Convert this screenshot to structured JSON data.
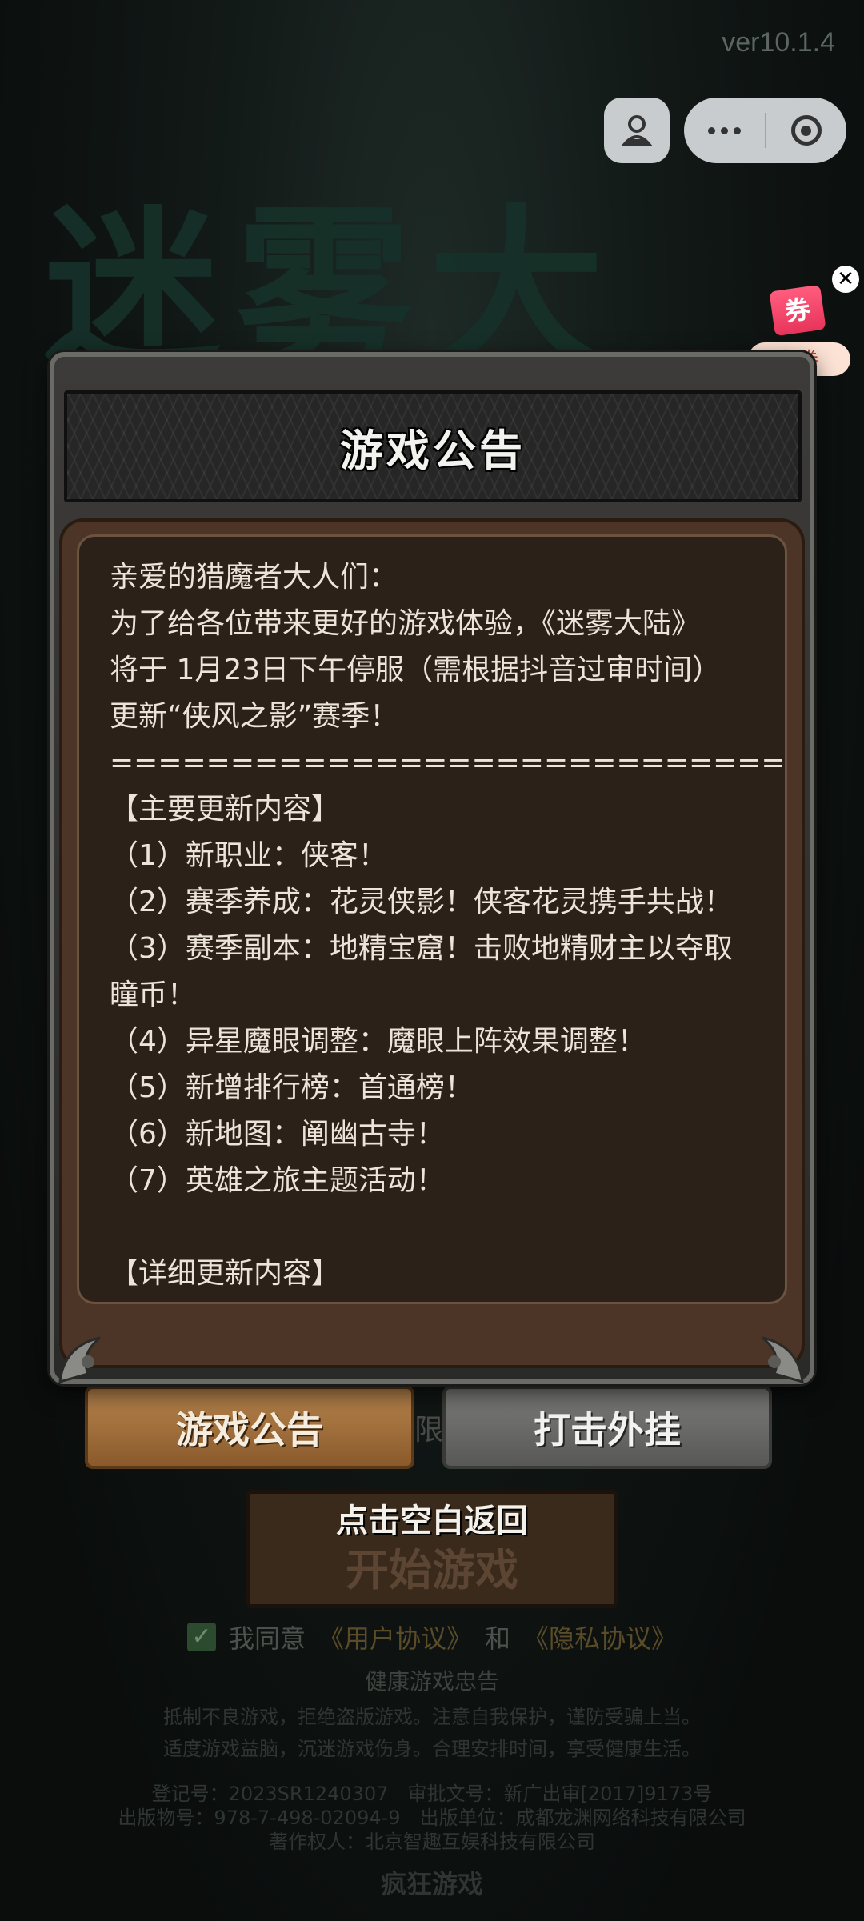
{
  "version": "ver10.1.4",
  "logo": {
    "text": "迷雾大陆"
  },
  "capsule": {
    "left_icon": "game-avatar-icon",
    "more_icon": "more-dots-icon",
    "close_icon": "target-close-icon"
  },
  "coupon": {
    "ticket": "券",
    "label": "领券",
    "close": "✕"
  },
  "notice": {
    "title": "游戏公告",
    "lines": [
      "亲爱的猎魔者大人们：",
      "为了给各位带来更好的游戏体验，《迷雾大陆》",
      "将于 1月23日下午停服（需根据抖音过审时间）",
      "更新“侠风之影”赛季！",
      "============================",
      "【主要更新内容】",
      "（1）新职业：侠客！",
      "（2）赛季养成：花灵侠影！侠客花灵携手共战！",
      "（3）赛季副本：地精宝窟！击败地精财主以夺取",
      "瞳币！",
      "（4）异星魔眼调整：魔眼上阵效果调整！",
      "（5）新增排行榜：首通榜！",
      "（6）新地图：阐幽古寺！",
      "（7）英雄之旅主题活动！",
      "",
      "【详细更新内容】"
    ]
  },
  "buttons": {
    "notice": "游戏公告",
    "anti_cheat": "打击外挂",
    "start": "开始游戏",
    "back_hint": "点击空白返回",
    "between_char": "限"
  },
  "agreement": {
    "prefix": "我同意",
    "user": "《用户协议》",
    "and": "和",
    "privacy": "《隐私协议》",
    "checked": "✓"
  },
  "footer": {
    "health_title": "健康游戏忠告",
    "health_1": "抵制不良游戏，拒绝盗版游戏。注意自我保护，谨防受骗上当。",
    "health_2": "适度游戏益脑，沉迷游戏伤身。合理安排时间，享受健康生活。",
    "reg": "登记号：2023SR1240307　审批文号：新广出审[2017]9173号",
    "isbn": "出版物号：978-7-498-02094-9　出版单位：成都龙渊网络科技有限公司",
    "owner": "著作权人：北京智趣互娱科技有限公司",
    "brand": "疯狂游戏"
  },
  "colors": {
    "panel_body": "#4c3526",
    "notice_button": "#b8854d",
    "cheat_button": "#6a6a68",
    "coupon_red": "#e8345b"
  }
}
